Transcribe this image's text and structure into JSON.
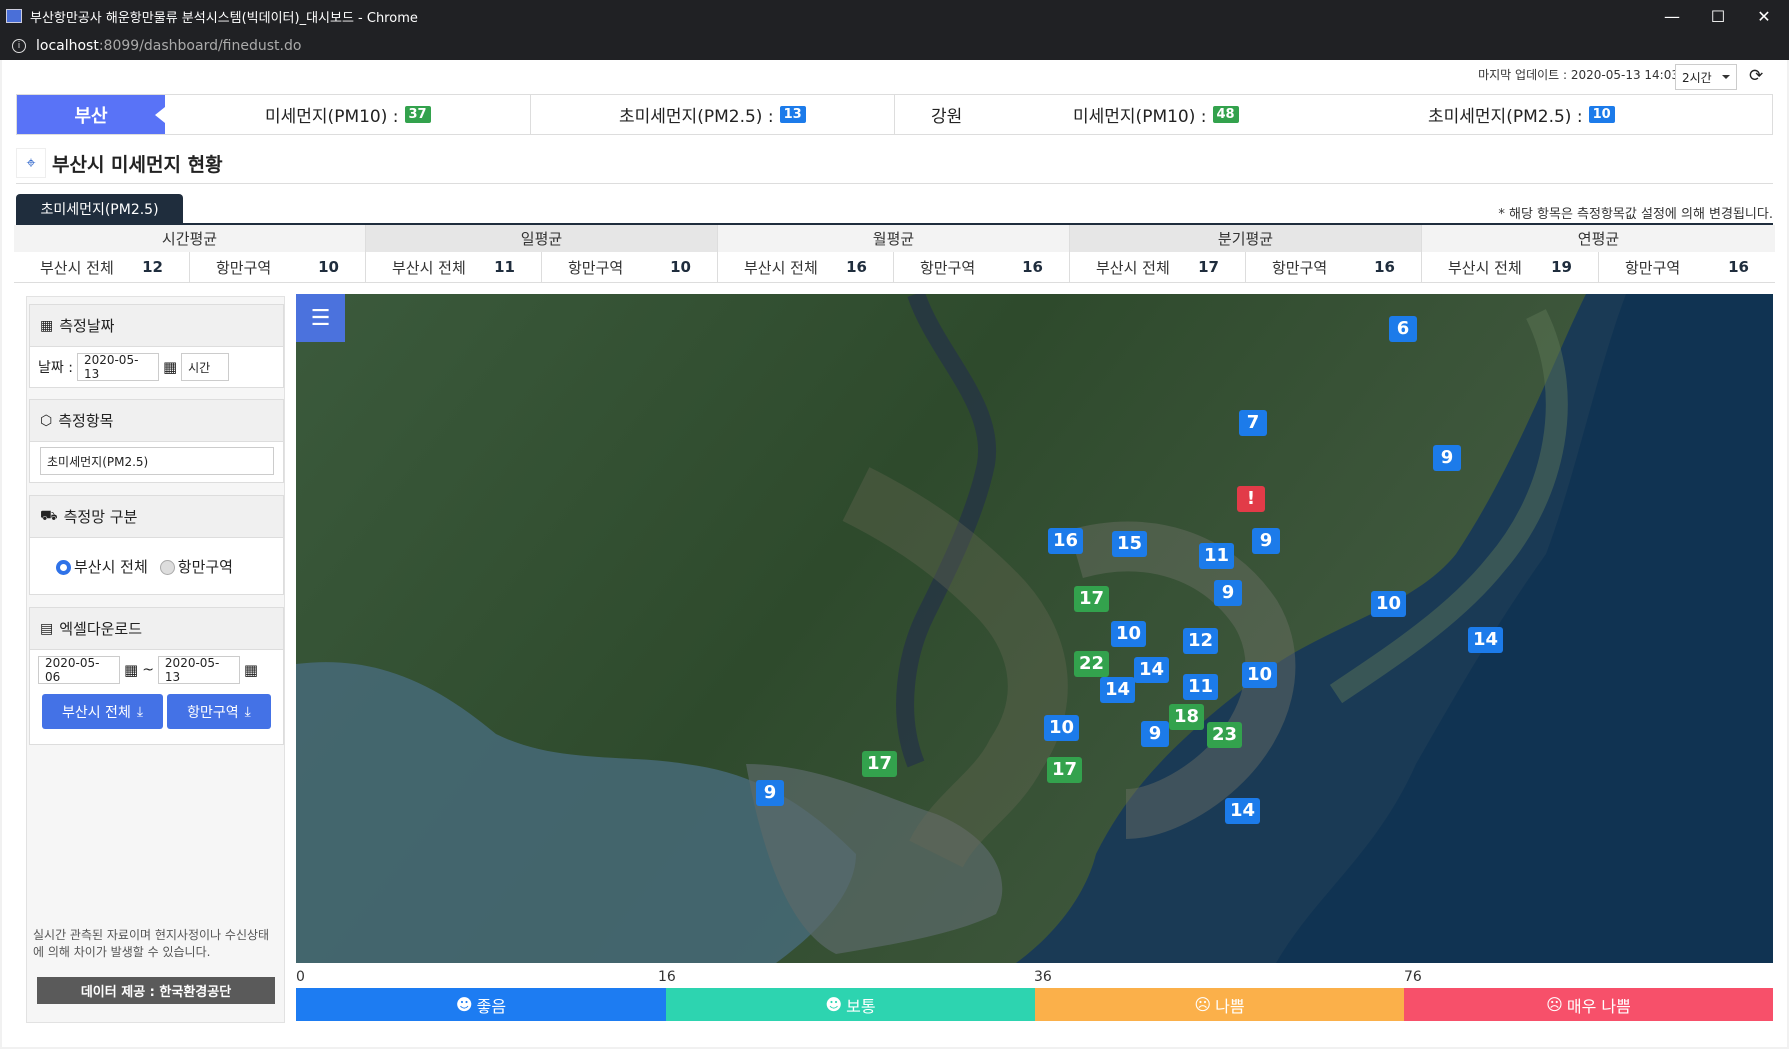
{
  "window": {
    "title": "부산항만공사 해운항만물류 분석시스템(빅데이터)_대시보드 - Chrome",
    "min": "—",
    "max": "☐",
    "close": "✕"
  },
  "url": {
    "host": "localhost",
    "path": ":8099/dashboard/finedust.do"
  },
  "update": {
    "label": "마지막 업데이트 : 2020-05-13 14:03",
    "interval": "2시간"
  },
  "region": {
    "busan": {
      "name": "부산",
      "pm10_label": "미세먼지(PM10) :",
      "pm10": "37",
      "pm25_label": "초미세먼지(PM2.5) :",
      "pm25": "13"
    },
    "gangwon": {
      "name": "강원",
      "pm10_label": "미세먼지(PM10) :",
      "pm10": "48",
      "pm25_label": "초미세먼지(PM2.5) :",
      "pm25": "10"
    }
  },
  "page_title": "부산시 미세먼지 현황",
  "tab": "초미세먼지(PM2.5)",
  "note": "* 해당 항목은 측정항목값 설정에 의해 변경됩니다.",
  "averages": [
    {
      "h": "시간평균",
      "a_label": "부산시 전체",
      "a": "12",
      "b_label": "항만구역",
      "b": "10"
    },
    {
      "h": "일평균",
      "a_label": "부산시 전체",
      "a": "11",
      "b_label": "항만구역",
      "b": "10"
    },
    {
      "h": "월평균",
      "a_label": "부산시 전체",
      "a": "16",
      "b_label": "항만구역",
      "b": "16"
    },
    {
      "h": "분기평균",
      "a_label": "부산시 전체",
      "a": "17",
      "b_label": "항만구역",
      "b": "16"
    },
    {
      "h": "연평균",
      "a_label": "부산시 전체",
      "a": "19",
      "b_label": "항만구역",
      "b": "16"
    }
  ],
  "side": {
    "date": {
      "title": "측정날짜",
      "label": "날짜 :",
      "value": "2020-05-13",
      "unit": "시간"
    },
    "item": {
      "title": "측정항목",
      "value": "초미세먼지(PM2.5)"
    },
    "net": {
      "title": "측정망 구분",
      "opt1": "부산시 전체",
      "opt2": "항만구역"
    },
    "excel": {
      "title": "엑셀다운로드",
      "from": "2020-05-06",
      "tilde": "~",
      "to": "2020-05-13",
      "btn1": "부산시 전체",
      "btn2": "항만구역"
    },
    "foot": "실시간 관측된 자료이며 현지사정이나 수신상태에 의해 차이가 발생할 수 있습니다.",
    "source": "데이터 제공 : 한국환경공단"
  },
  "markers": [
    {
      "v": "6",
      "c": "b"
    },
    {
      "v": "7",
      "c": "b"
    },
    {
      "v": "9",
      "c": "b"
    },
    {
      "v": "!",
      "c": "r"
    },
    {
      "v": "16",
      "c": "b"
    },
    {
      "v": "15",
      "c": "b"
    },
    {
      "v": "11",
      "c": "b"
    },
    {
      "v": "9",
      "c": "b"
    },
    {
      "v": "9",
      "c": "b"
    },
    {
      "v": "17",
      "c": "g"
    },
    {
      "v": "10",
      "c": "b"
    },
    {
      "v": "10",
      "c": "b"
    },
    {
      "v": "12",
      "c": "b"
    },
    {
      "v": "14",
      "c": "b"
    },
    {
      "v": "22",
      "c": "g"
    },
    {
      "v": "14",
      "c": "b"
    },
    {
      "v": "14",
      "c": "b"
    },
    {
      "v": "11",
      "c": "b"
    },
    {
      "v": "10",
      "c": "b"
    },
    {
      "v": "18",
      "c": "g"
    },
    {
      "v": "10",
      "c": "b"
    },
    {
      "v": "9",
      "c": "b"
    },
    {
      "v": "23",
      "c": "g"
    },
    {
      "v": "17",
      "c": "g"
    },
    {
      "v": "17",
      "c": "g"
    },
    {
      "v": "9",
      "c": "b"
    },
    {
      "v": "14",
      "c": "b"
    }
  ],
  "legend": {
    "ticks": [
      "0",
      "16",
      "36",
      "76"
    ],
    "levels": [
      {
        "label": "좋음",
        "color": "#1d7cf2"
      },
      {
        "label": "보통",
        "color": "#2dd4b0"
      },
      {
        "label": "나쁨",
        "color": "#fbb04a"
      },
      {
        "label": "매우 나쁨",
        "color": "#f7506a"
      }
    ]
  }
}
